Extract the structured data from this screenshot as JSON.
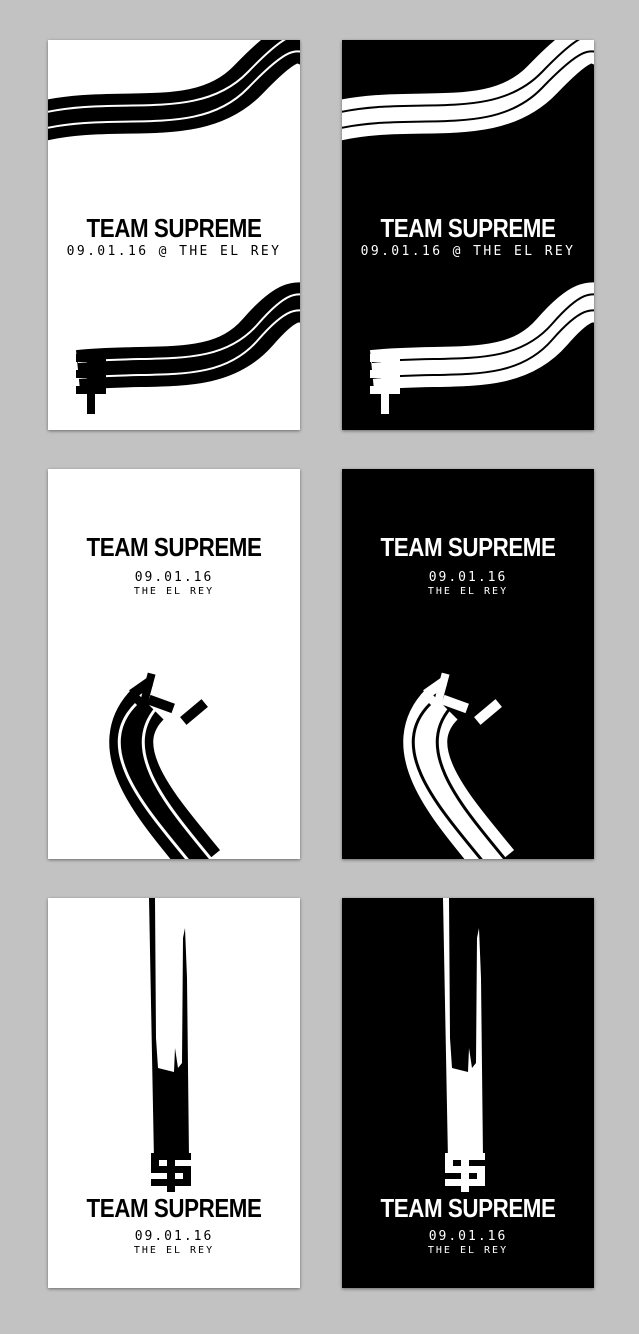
{
  "cards": [
    {
      "title": "TEAM SUPREME",
      "line1": "09.01.16 @ THE EL REY"
    },
    {
      "title": "TEAM SUPREME",
      "line1": "09.01.16 @ THE EL REY"
    },
    {
      "title": "TEAM SUPREME",
      "line1": "09.01.16",
      "line2": "THE EL REY"
    },
    {
      "title": "TEAM SUPREME",
      "line1": "09.01.16",
      "line2": "THE EL REY"
    },
    {
      "title": "TEAM SUPREME",
      "line1": "09.01.16",
      "line2": "THE EL REY"
    },
    {
      "title": "TEAM SUPREME",
      "line1": "09.01.16",
      "line2": "THE EL REY"
    }
  ],
  "colors": {
    "background": "#c2c2c2",
    "light_card": "#ffffff",
    "dark_card": "#000000"
  },
  "icons": [
    "brush-stroke-graphic",
    "ts-monogram-logo"
  ]
}
